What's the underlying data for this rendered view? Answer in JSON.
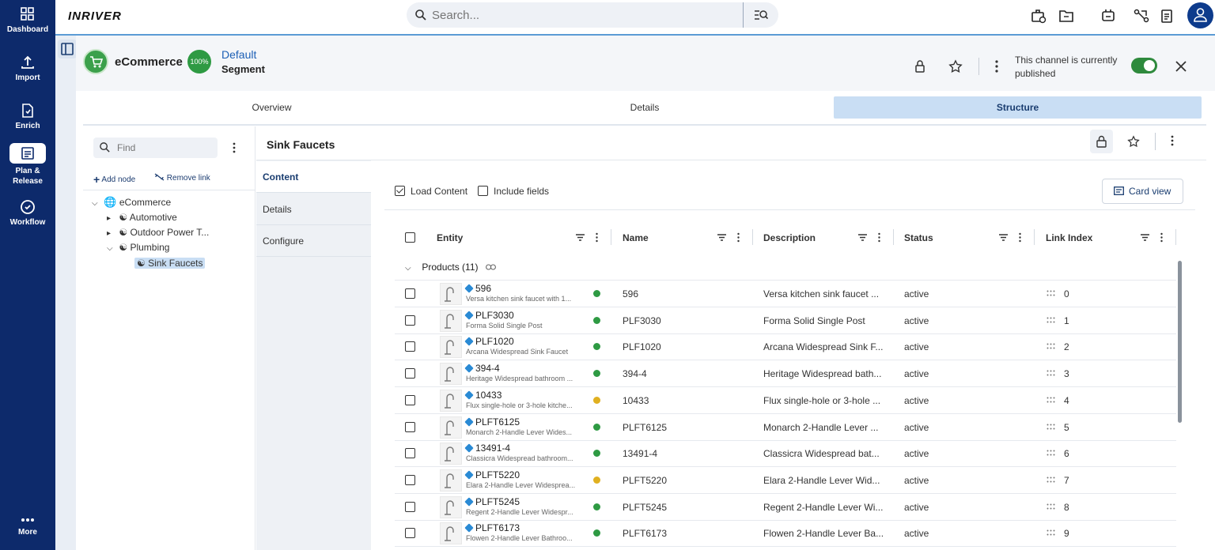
{
  "nav": {
    "items": [
      {
        "label": "Dashboard",
        "icon": "dashboard-icon"
      },
      {
        "label": "Import",
        "icon": "import-icon"
      },
      {
        "label": "Enrich",
        "icon": "enrich-icon"
      },
      {
        "label": "Plan &\nRelease",
        "icon": "plan-release-icon"
      },
      {
        "label": "Workflow",
        "icon": "workflow-icon"
      },
      {
        "label": "More",
        "icon": "more-icon"
      }
    ],
    "active": "Plan & Release"
  },
  "topbar": {
    "logo": "INRIVER",
    "search_placeholder": "Search..."
  },
  "channel": {
    "name": "eCommerce",
    "completeness": "100%",
    "segment_link": "Default",
    "segment_label": "Segment",
    "published_text": "This channel is currently published",
    "published": true
  },
  "tabs": [
    {
      "label": "Overview",
      "active": false
    },
    {
      "label": "Details",
      "active": false
    },
    {
      "label": "Structure",
      "active": true
    }
  ],
  "tree": {
    "find_placeholder": "Find",
    "add_node": "Add node",
    "remove_link": "Remove link",
    "nodes": [
      {
        "label": "eCommerce",
        "level": 0,
        "expanded": true
      },
      {
        "label": "Automotive",
        "level": 1,
        "expanded": false
      },
      {
        "label": "Outdoor Power T...",
        "level": 1,
        "expanded": false
      },
      {
        "label": "Plumbing",
        "level": 1,
        "expanded": true
      },
      {
        "label": "Sink Faucets",
        "level": 2,
        "selected": true
      }
    ]
  },
  "node": {
    "title": "Sink Faucets",
    "subnav": [
      "Content",
      "Details",
      "Configure"
    ],
    "load_content_label": "Load Content",
    "load_content_checked": true,
    "include_fields_label": "Include fields",
    "include_fields_checked": false,
    "card_view_label": "Card view"
  },
  "grid": {
    "columns": [
      "Entity",
      "Name",
      "Description",
      "Status",
      "Link Index"
    ],
    "group_label": "Products (11)",
    "colors": {
      "green": "#2e9a43",
      "yellow": "#e0b020"
    },
    "rows": [
      {
        "id": "596",
        "desc": "Versa kitchen sink faucet with 1...",
        "dot": "green",
        "name": "596",
        "description": "Versa kitchen sink faucet ...",
        "status": "active",
        "index": "0"
      },
      {
        "id": "PLF3030",
        "desc": "Forma Solid Single Post",
        "dot": "green",
        "name": "PLF3030",
        "description": "Forma Solid Single Post",
        "status": "active",
        "index": "1"
      },
      {
        "id": "PLF1020",
        "desc": "Arcana Widespread Sink Faucet",
        "dot": "green",
        "name": "PLF1020",
        "description": "Arcana Widespread Sink F...",
        "status": "active",
        "index": "2"
      },
      {
        "id": "394-4",
        "desc": "Heritage Widespread bathroom ...",
        "dot": "green",
        "name": "394-4",
        "description": "Heritage Widespread bath...",
        "status": "active",
        "index": "3"
      },
      {
        "id": "10433",
        "desc": "Flux single-hole or 3-hole kitche...",
        "dot": "yellow",
        "name": "10433",
        "description": "Flux single-hole or 3-hole ...",
        "status": "active",
        "index": "4"
      },
      {
        "id": "PLFT6125",
        "desc": "Monarch 2-Handle Lever Wides...",
        "dot": "green",
        "name": "PLFT6125",
        "description": "Monarch 2-Handle Lever ...",
        "status": "active",
        "index": "5"
      },
      {
        "id": "13491-4",
        "desc": "Classicra Widespread bathroom...",
        "dot": "green",
        "name": "13491-4",
        "description": "Classicra Widespread bat...",
        "status": "active",
        "index": "6"
      },
      {
        "id": "PLFT5220",
        "desc": "Elara 2-Handle Lever Widesprea...",
        "dot": "yellow",
        "name": "PLFT5220",
        "description": "Elara 2-Handle Lever Wid...",
        "status": "active",
        "index": "7"
      },
      {
        "id": "PLFT5245",
        "desc": "Regent 2-Handle Lever Widespr...",
        "dot": "green",
        "name": "PLFT5245",
        "description": "Regent 2-Handle Lever Wi...",
        "status": "active",
        "index": "8"
      },
      {
        "id": "PLFT6173",
        "desc": "Flowen 2-Handle Lever Bathroo...",
        "dot": "green",
        "name": "PLFT6173",
        "description": "Flowen 2-Handle Lever Ba...",
        "status": "active",
        "index": "9"
      }
    ]
  }
}
